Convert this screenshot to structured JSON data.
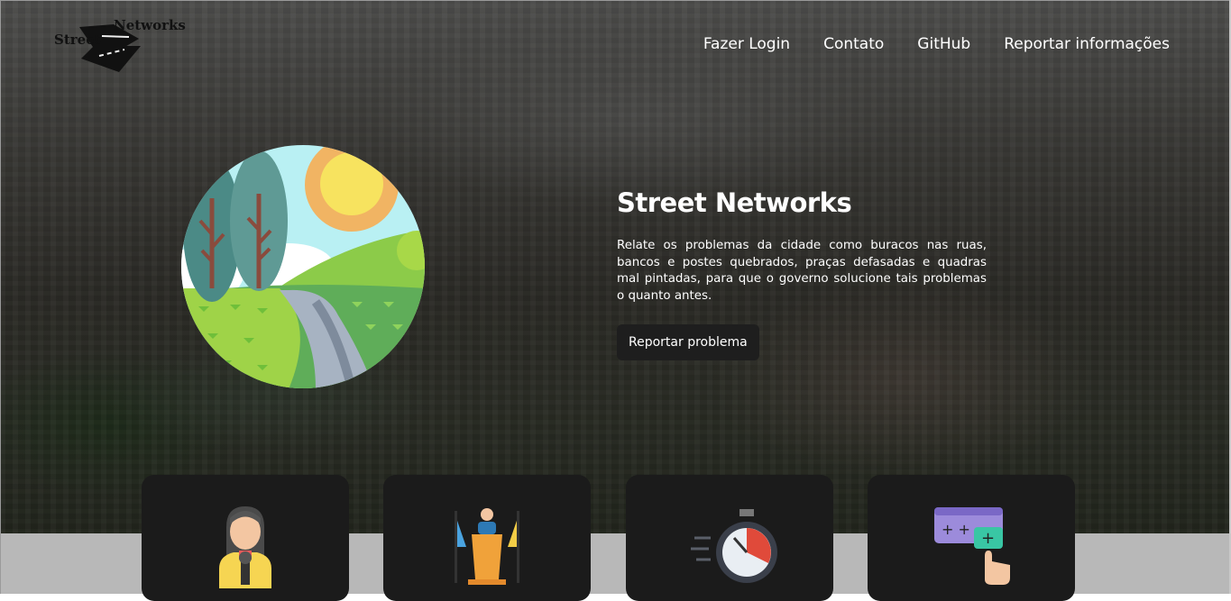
{
  "header": {
    "logo": {
      "word_top": "Networks",
      "word_left": "Street"
    },
    "nav": [
      {
        "label": "Fazer Login"
      },
      {
        "label": "Contato"
      },
      {
        "label": "GitHub"
      },
      {
        "label": "Reportar informações"
      }
    ]
  },
  "hero": {
    "illustration": "landscape-illustration",
    "title": "Street Networks",
    "description": "Relate os problemas da cidade como buracos nas ruas, bancos e postes quebrados, praças defasadas e quadras mal pintadas, para que o governo solucione tais problemas o quanto antes.",
    "cta_label": "Reportar problema"
  },
  "cards": [
    {
      "icon": "reporter-icon"
    },
    {
      "icon": "podium-icon"
    },
    {
      "icon": "stopwatch-icon"
    },
    {
      "icon": "add-form-icon"
    }
  ],
  "colors": {
    "card_bg": "#1b1b1b",
    "button_bg": "#1e1e1e",
    "text": "#ffffff"
  }
}
